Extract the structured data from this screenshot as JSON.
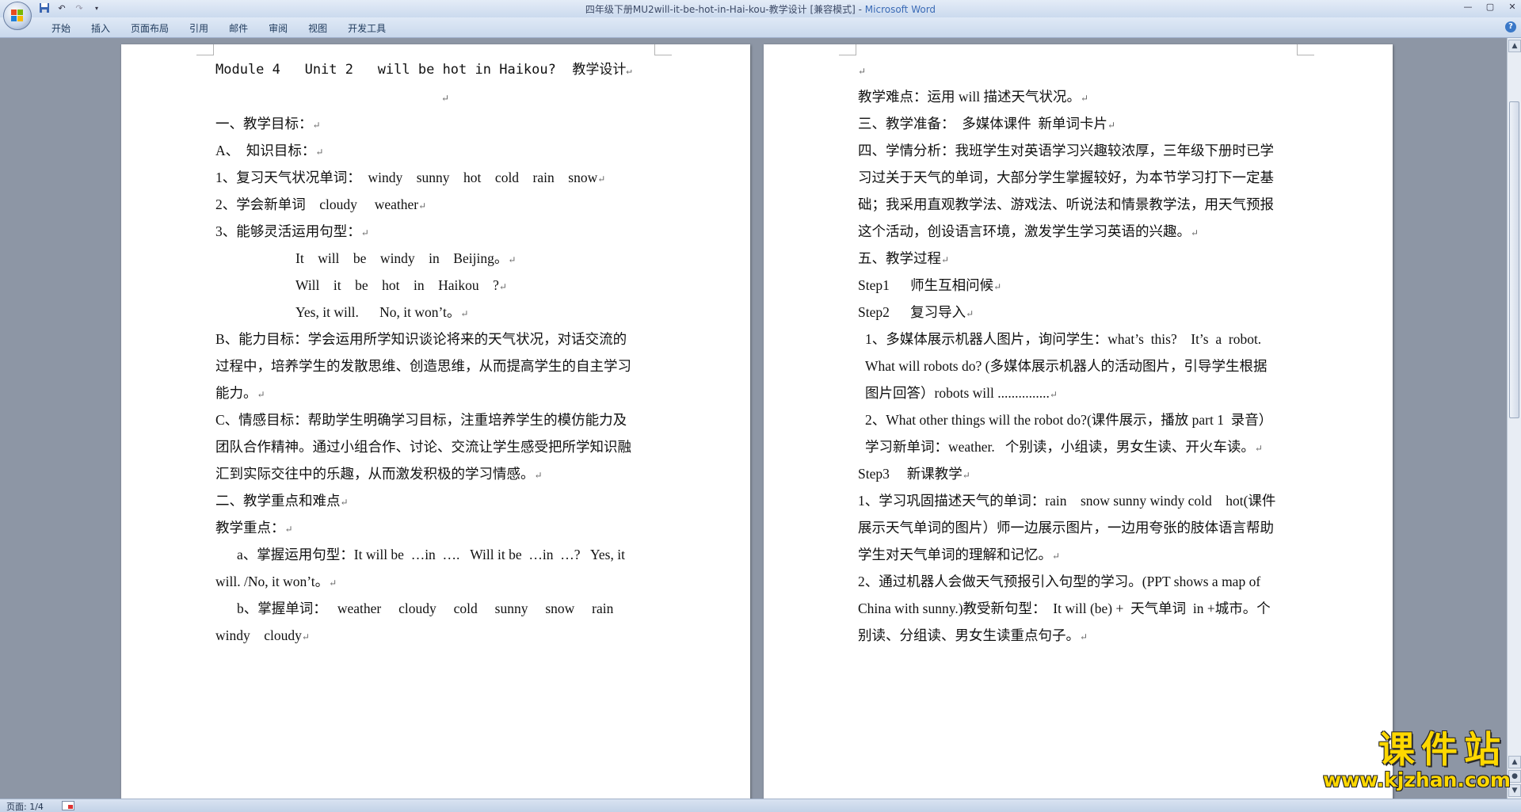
{
  "window": {
    "title_doc": "四年级下册MU2will-it-be-hot-in-Hai-kou-教学设计 [兼容模式] - ",
    "title_app": "Microsoft Word"
  },
  "icons": {
    "office_button": "office-logo-icon",
    "save": "save-icon",
    "undo": "undo-icon",
    "redo": "redo-icon",
    "customize": "customize-qat-icon",
    "minimize": "minimize-icon",
    "maximize": "maximize-icon",
    "close": "close-icon",
    "help": "help-icon"
  },
  "ribbon": {
    "tabs": [
      "开始",
      "插入",
      "页面布局",
      "引用",
      "邮件",
      "审阅",
      "视图",
      "开发工具"
    ]
  },
  "page1": {
    "lines": [
      "Module 4   Unit 2   will be hot in Haikou?  教学设计",
      "",
      "一、教学目标：",
      "A、  知识目标：",
      "1、复习天气状况单词：  windy    sunny    hot    cold    rain    snow",
      "2、学会新单词    cloudy     weather",
      "3、能够灵活运用句型：",
      "It    will    be    windy    in    Beijing。",
      "Will    it    be    hot    in    Haikou    ?",
      "Yes, it will.      No, it won’t。",
      "B、能力目标：学会运用所学知识谈论将来的天气状况，对话交流的",
      "过程中，培养学生的发散思维、创造思维，从而提高学生的自主学习",
      "能力。",
      "C、情感目标：帮助学生明确学习目标，注重培养学生的模仿能力及",
      "团队合作精神。通过小组合作、讨论、交流让学生感受把所学知识融",
      "汇到实际交往中的乐趣，从而激发积极的学习情感。",
      "二、教学重点和难点",
      "教学重点：",
      "a、掌握运用句型：It will be  …in  ….   Will it be  …in  …?   Yes, it",
      "will. /No, it won’t。",
      "b、掌握单词：   weather     cloudy     cold     sunny     snow     rain",
      "windy    cloudy"
    ]
  },
  "page2": {
    "lines": [
      "",
      "教学难点：运用 will 描述天气状况。",
      "三、教学准备：  多媒体课件  新单词卡片",
      "四、学情分析：我班学生对英语学习兴趣较浓厚，三年级下册时已学",
      "习过关于天气的单词，大部分学生掌握较好，为本节学习打下一定基",
      "础；我采用直观教学法、游戏法、听说法和情景教学法，用天气预报",
      "这个活动，创设语言环境，激发学生学习英语的兴趣。",
      "五、教学过程",
      "Step1      师生互相问候",
      "Step2      复习导入",
      "1、多媒体展示机器人图片，询问学生：what’s  this?    It’s  a  robot.",
      "What will robots do? (多媒体展示机器人的活动图片，引导学生根据",
      "图片回答）robots will ...............",
      "2、What other things will the robot do?(课件展示，播放 part 1  录音）",
      "学习新单词：weather.   个别读，小组读，男女生读、开火车读。",
      "Step3     新课教学",
      "1、学习巩固描述天气的单词：rain    snow sunny windy cold    hot(课件",
      "展示天气单词的图片）师一边展示图片，一边用夸张的肢体语言帮助",
      "学生对天气单词的理解和记忆。",
      "2、通过机器人会做天气预报引入句型的学习。(PPT shows a map of",
      "China with sunny.)教受新句型：  It will (be) +  天气单词  in +城市。个",
      "别读、分组读、男女生读重点句子。"
    ]
  },
  "status": {
    "page": "页面: 1/4"
  },
  "watermark": {
    "text": "课件站",
    "url": "www.kjzhan.com"
  },
  "colors": {
    "workspace": "#8d96a5",
    "ribbon": "#dfe9f6",
    "watermark": "#ffd800"
  }
}
